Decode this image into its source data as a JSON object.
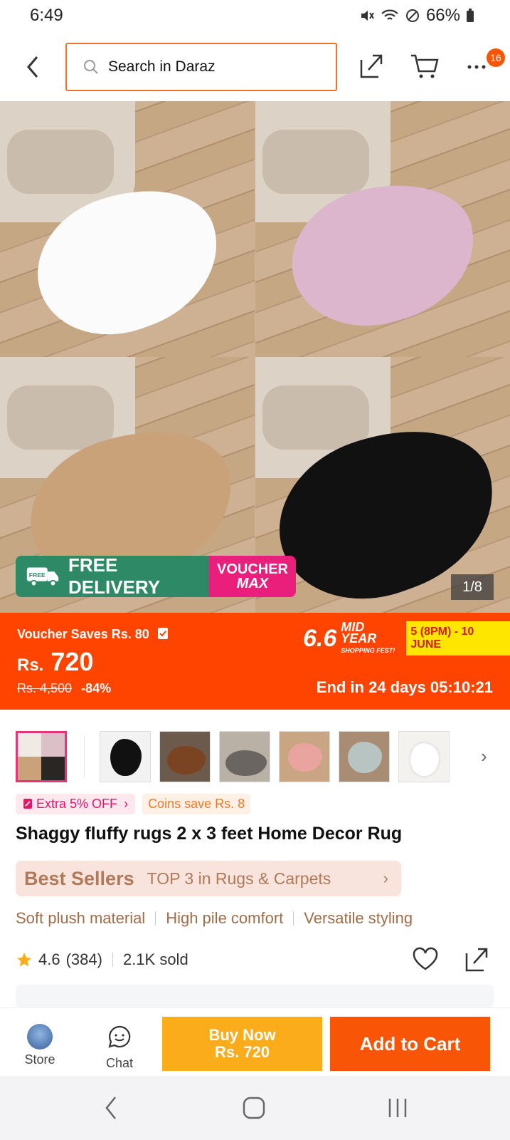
{
  "status": {
    "time": "6:49",
    "battery": "66%"
  },
  "search": {
    "placeholder": "Search in Daraz"
  },
  "header": {
    "cart_badge": "16"
  },
  "promo": {
    "free_tag": "FREE",
    "free_label": "FREE DELIVERY",
    "voucher_line1": "VOUCHER",
    "voucher_line2": "MAX"
  },
  "gallery": {
    "counter": "1/8"
  },
  "price": {
    "voucher_saves": "Voucher Saves Rs. 80",
    "currency": "Rs.",
    "amount": "720",
    "original": "Rs. 4,500",
    "discount": "-84%",
    "event_big": "6.6",
    "event_mid1": "MID YEAR",
    "event_mid2": "SHOPPING FEST!",
    "event_dates": "5 (8PM) - 10 JUNE",
    "ends": "End in 24 days 05:10:21"
  },
  "tags": {
    "extra": "Extra 5% OFF",
    "coins": "Coins save Rs. 8"
  },
  "product": {
    "title": "Shaggy fluffy rugs 2 x 3 feet Home Decor Rug"
  },
  "best": {
    "label": "Best Sellers",
    "rank": "TOP 3 in Rugs & Carpets"
  },
  "features": [
    "Soft plush material",
    "High pile comfort",
    "Versatile styling"
  ],
  "rating": {
    "score": "4.6",
    "count": "(384)",
    "sold": "2.1K sold"
  },
  "bottom": {
    "store": "Store",
    "chat": "Chat",
    "buy_now": "Buy Now",
    "buy_price": "Rs. 720",
    "add_to_cart": "Add to Cart"
  },
  "colors": {
    "accent": "#f85606",
    "band": "#ff4400",
    "buy": "#fbac1b"
  }
}
